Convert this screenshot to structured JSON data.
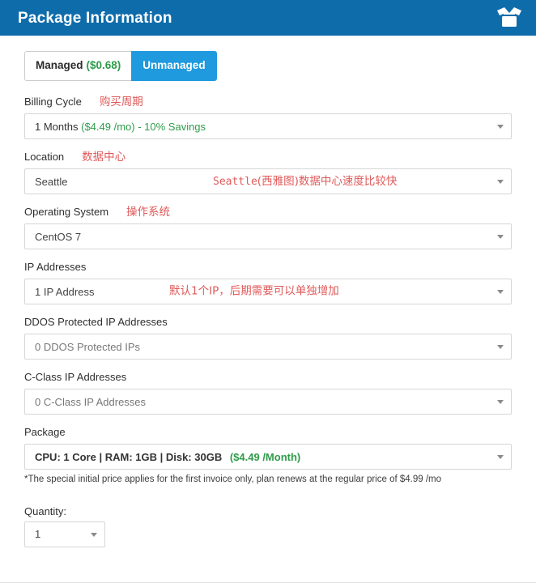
{
  "header": {
    "title": "Package Information",
    "icon": "open-box-icon",
    "background_color": "#0e6cab"
  },
  "plan_toggle": {
    "managed_label": "Managed",
    "managed_price": "($0.68)",
    "unmanaged_label": "Unmanaged",
    "selected": "Unmanaged",
    "accent_color": "#1f9ade",
    "price_color": "#2e9c4a"
  },
  "fields": {
    "billing_cycle": {
      "label": "Billing Cycle",
      "annotation": "购买周期",
      "value_main": "1 Months",
      "value_price": "($4.49 /mo)",
      "value_savings": "-  10% Savings"
    },
    "location": {
      "label": "Location",
      "annotation": "数据中心",
      "value": "Seattle",
      "inline_annotation_mono": "Seattle",
      "inline_annotation_cn": "(西雅图)数据中心速度比较快"
    },
    "operating_system": {
      "label": "Operating System",
      "annotation": "操作系统",
      "value": "CentOS 7"
    },
    "ip_addresses": {
      "label": "IP Addresses",
      "value": "1 IP Address",
      "inline_annotation": "默认1个IP，后期需要可以单独增加"
    },
    "ddos_ip_addresses": {
      "label": "DDOS Protected IP Addresses",
      "value": "0 DDOS Protected IPs"
    },
    "c_class_ip_addresses": {
      "label": "C-Class IP Addresses",
      "value": "0 C-Class IP Addresses"
    },
    "package": {
      "label": "Package",
      "value_specs": "CPU: 1 Core | RAM: 1GB | Disk: 30GB",
      "value_price": "($4.49 /Month)",
      "note": "*The special initial price applies for the first invoice only, plan renews at the regular price of $4.99 /mo"
    },
    "quantity": {
      "label": "Quantity:",
      "value": "1"
    }
  },
  "annotation_color": "#e05a5a"
}
